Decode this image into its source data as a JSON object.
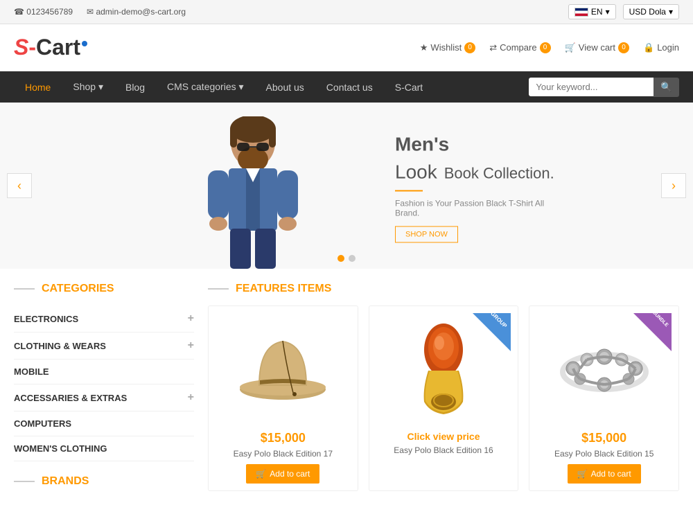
{
  "topbar": {
    "phone": "0123456789",
    "email": "admin-demo@s-cart.org",
    "phone_icon": "☎",
    "email_icon": "✉",
    "lang": "EN",
    "currency": "USD Dola"
  },
  "header": {
    "logo_s": "S",
    "logo_cart": "Cart",
    "wishlist": "Wishlist",
    "compare": "Compare",
    "viewcart": "View cart",
    "login": "Login",
    "wishlist_count": "0",
    "compare_count": "0",
    "cart_count": "0"
  },
  "nav": {
    "items": [
      {
        "label": "Home",
        "active": true,
        "has_arrow": false
      },
      {
        "label": "Shop",
        "active": false,
        "has_arrow": true
      },
      {
        "label": "Blog",
        "active": false,
        "has_arrow": false
      },
      {
        "label": "CMS categories",
        "active": false,
        "has_arrow": true
      },
      {
        "label": "About us",
        "active": false,
        "has_arrow": false
      },
      {
        "label": "Contact us",
        "active": false,
        "has_arrow": false
      },
      {
        "label": "S-Cart",
        "active": false,
        "has_arrow": false
      }
    ],
    "search_placeholder": "Your keyword..."
  },
  "slider": {
    "heading_bold": "Men's",
    "heading_light": "Look",
    "heading_suffix": "Book Collection.",
    "subtext": "Fashion is Your Passion Black T-Shirt All Brand.",
    "cta": "SHOP NOW",
    "dots": [
      true,
      false
    ]
  },
  "sidebar": {
    "categories_title": "CATEGORIES",
    "categories": [
      {
        "name": "ELECTRONICS",
        "has_plus": true
      },
      {
        "name": "CLOTHING & WEARS",
        "has_plus": true
      },
      {
        "name": "MOBILE",
        "has_plus": false
      },
      {
        "name": "ACCESSARIES & EXTRAS",
        "has_plus": true
      },
      {
        "name": "COMPUTERS",
        "has_plus": false
      },
      {
        "name": "WOMEN'S CLOTHING",
        "has_plus": false
      }
    ],
    "brands_title": "BRANDS"
  },
  "featured": {
    "title": "FEATURES ITEMS",
    "products": [
      {
        "id": 1,
        "name": "Easy Polo Black Edition 17",
        "price": "$15,000",
        "price_type": "fixed",
        "badge": null,
        "add_to_cart": "Add to cart"
      },
      {
        "id": 2,
        "name": "Easy Polo Black Edition 16",
        "price": "Click view price",
        "price_type": "click",
        "badge": "GROUP",
        "add_to_cart": null
      },
      {
        "id": 3,
        "name": "Easy Polo Black Edition 15",
        "price": "$15,000",
        "price_type": "fixed",
        "badge": "BUNDLE",
        "add_to_cart": "Add to cart"
      }
    ]
  }
}
